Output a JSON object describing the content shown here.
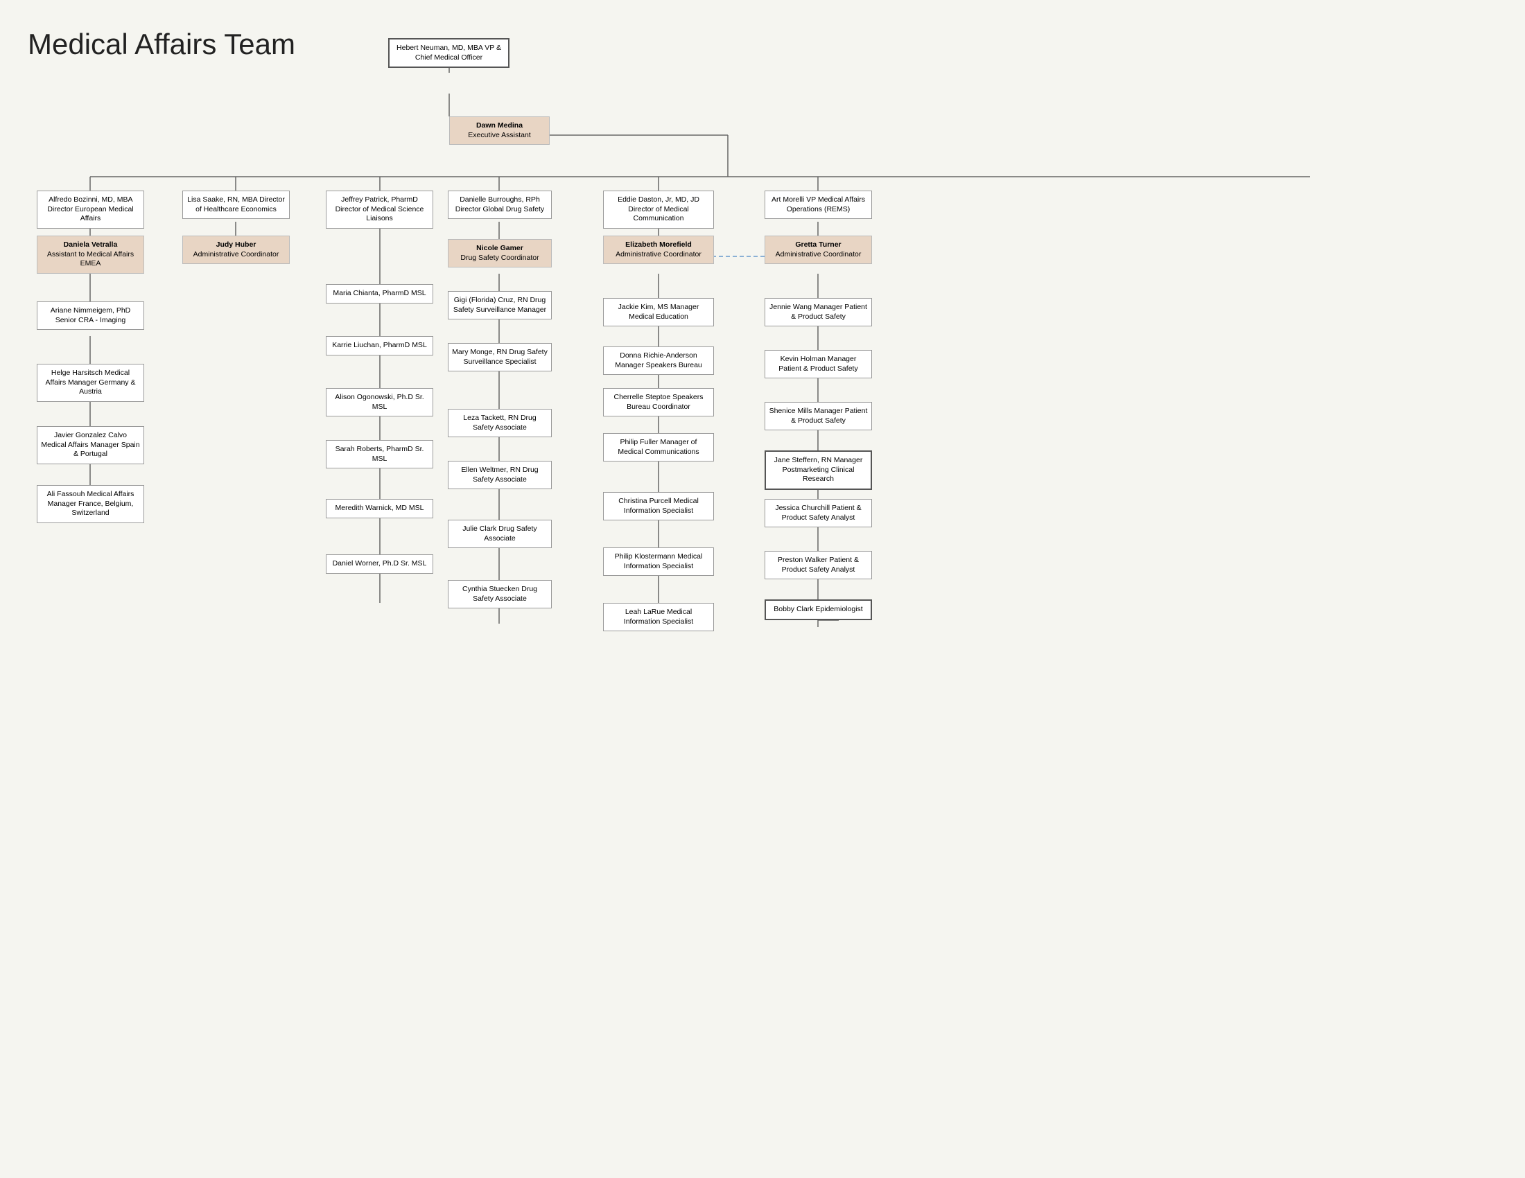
{
  "title": "Medical Affairs Team",
  "nodes": {
    "cmo": {
      "name": "Hebert Neuman, MD, MBA",
      "title": "VP & Chief Medical Officer"
    },
    "dawn": {
      "name": "Dawn Medina",
      "title": "Executive Assistant"
    },
    "alfredo": {
      "name": "Alfredo Bozinni, MD, MBA",
      "title": "Director\nEuropean Medical Affairs"
    },
    "daniela": {
      "name": "Daniela Vetralla",
      "title": "Assistant to Medical Affairs EMEA"
    },
    "ariane": {
      "name": "Ariane Nimmeigem, PhD",
      "title": "Senior CRA - Imaging"
    },
    "helge": {
      "name": "Helge Harsitsch",
      "title": "Medical Affairs Manager Germany & Austria"
    },
    "javier": {
      "name": "Javier Gonzalez Calvo",
      "title": "Medical Affairs Manager Spain & Portugal"
    },
    "ali": {
      "name": "Ali Fassouh",
      "title": "Medical Affairs Manager France, Belgium, Switzerland"
    },
    "lisa": {
      "name": "Lisa Saake, RN, MBA",
      "title": "Director of Healthcare Economics"
    },
    "judy": {
      "name": "Judy Huber",
      "title": "Administrative Coordinator"
    },
    "jeffrey": {
      "name": "Jeffrey Patrick, PharmD",
      "title": "Director of Medical Science Liaisons"
    },
    "maria": {
      "name": "Maria Chianta, PharmD",
      "title": "MSL"
    },
    "karrie": {
      "name": "Karrie Liuchan, PharmD",
      "title": "MSL"
    },
    "alison": {
      "name": "Alison Ogonowski, Ph.D",
      "title": "Sr. MSL"
    },
    "sarah": {
      "name": "Sarah Roberts, PharmD",
      "title": "Sr. MSL"
    },
    "meredith": {
      "name": "Meredith Warnick, MD",
      "title": "MSL"
    },
    "daniel": {
      "name": "Daniel Worner, Ph.D",
      "title": "Sr. MSL"
    },
    "danielle": {
      "name": "Danielle Burroughs, RPh",
      "title": "Director\nGlobal Drug Safety"
    },
    "nicole": {
      "name": "Nicole Gamer",
      "title": "Drug Safety Coordinator"
    },
    "gigi": {
      "name": "Gigi (Florida) Cruz, RN",
      "title": "Drug Safety Surveillance Manager"
    },
    "mary": {
      "name": "Mary Monge, RN",
      "title": "Drug Safety Surveillance Specialist"
    },
    "leza": {
      "name": "Leza Tackett, RN",
      "title": "Drug Safety Associate"
    },
    "ellen": {
      "name": "Ellen Weltmer, RN",
      "title": "Drug Safety Associate"
    },
    "julie": {
      "name": "Julie Clark",
      "title": "Drug Safety Associate"
    },
    "cynthia": {
      "name": "Cynthia Stuecken",
      "title": "Drug Safety Associate"
    },
    "eddie": {
      "name": "Eddie Daston, Jr, MD, JD",
      "title": "Director of Medical Communication"
    },
    "elizabeth": {
      "name": "Elizabeth Morefield",
      "title": "Administrative Coordinator"
    },
    "jackie": {
      "name": "Jackie Kim, MS",
      "title": "Manager\nMedical Education"
    },
    "donna": {
      "name": "Donna Richie-Anderson",
      "title": "Manager\nSpeakers Bureau"
    },
    "cherrelle": {
      "name": "Cherrelle Steptoe",
      "title": "Speakers Bureau Coordinator"
    },
    "philip_fuller": {
      "name": "Philip Fuller",
      "title": "Manager of Medical Communications"
    },
    "christina": {
      "name": "Christina Purcell",
      "title": "Medical Information Specialist"
    },
    "philip_klostermann": {
      "name": "Philip Klostermann",
      "title": "Medical Information Specialist"
    },
    "leah": {
      "name": "Leah LaRue",
      "title": "Medical Information Specialist"
    },
    "art": {
      "name": "Art Morelli",
      "title": "VP Medical Affairs Operations (REMS)"
    },
    "gretta": {
      "name": "Gretta Turner",
      "title": "Administrative Coordinator"
    },
    "jennie": {
      "name": "Jennie Wang",
      "title": "Manager\nPatient & Product Safety"
    },
    "kevin": {
      "name": "Kevin Holman",
      "title": "Manager\nPatient & Product Safety"
    },
    "shenice": {
      "name": "Shenice Mills",
      "title": "Manager\nPatient & Product Safety"
    },
    "jane": {
      "name": "Jane Steffern, RN",
      "title": "Manager\nPostmarketing Clinical Research"
    },
    "jessica": {
      "name": "Jessica Churchill",
      "title": "Patient & Product Safety Analyst"
    },
    "preston": {
      "name": "Preston Walker",
      "title": "Patient & Product Safety Analyst"
    },
    "bobby": {
      "name": "Bobby Clark",
      "title": "Epidemiologist"
    }
  }
}
